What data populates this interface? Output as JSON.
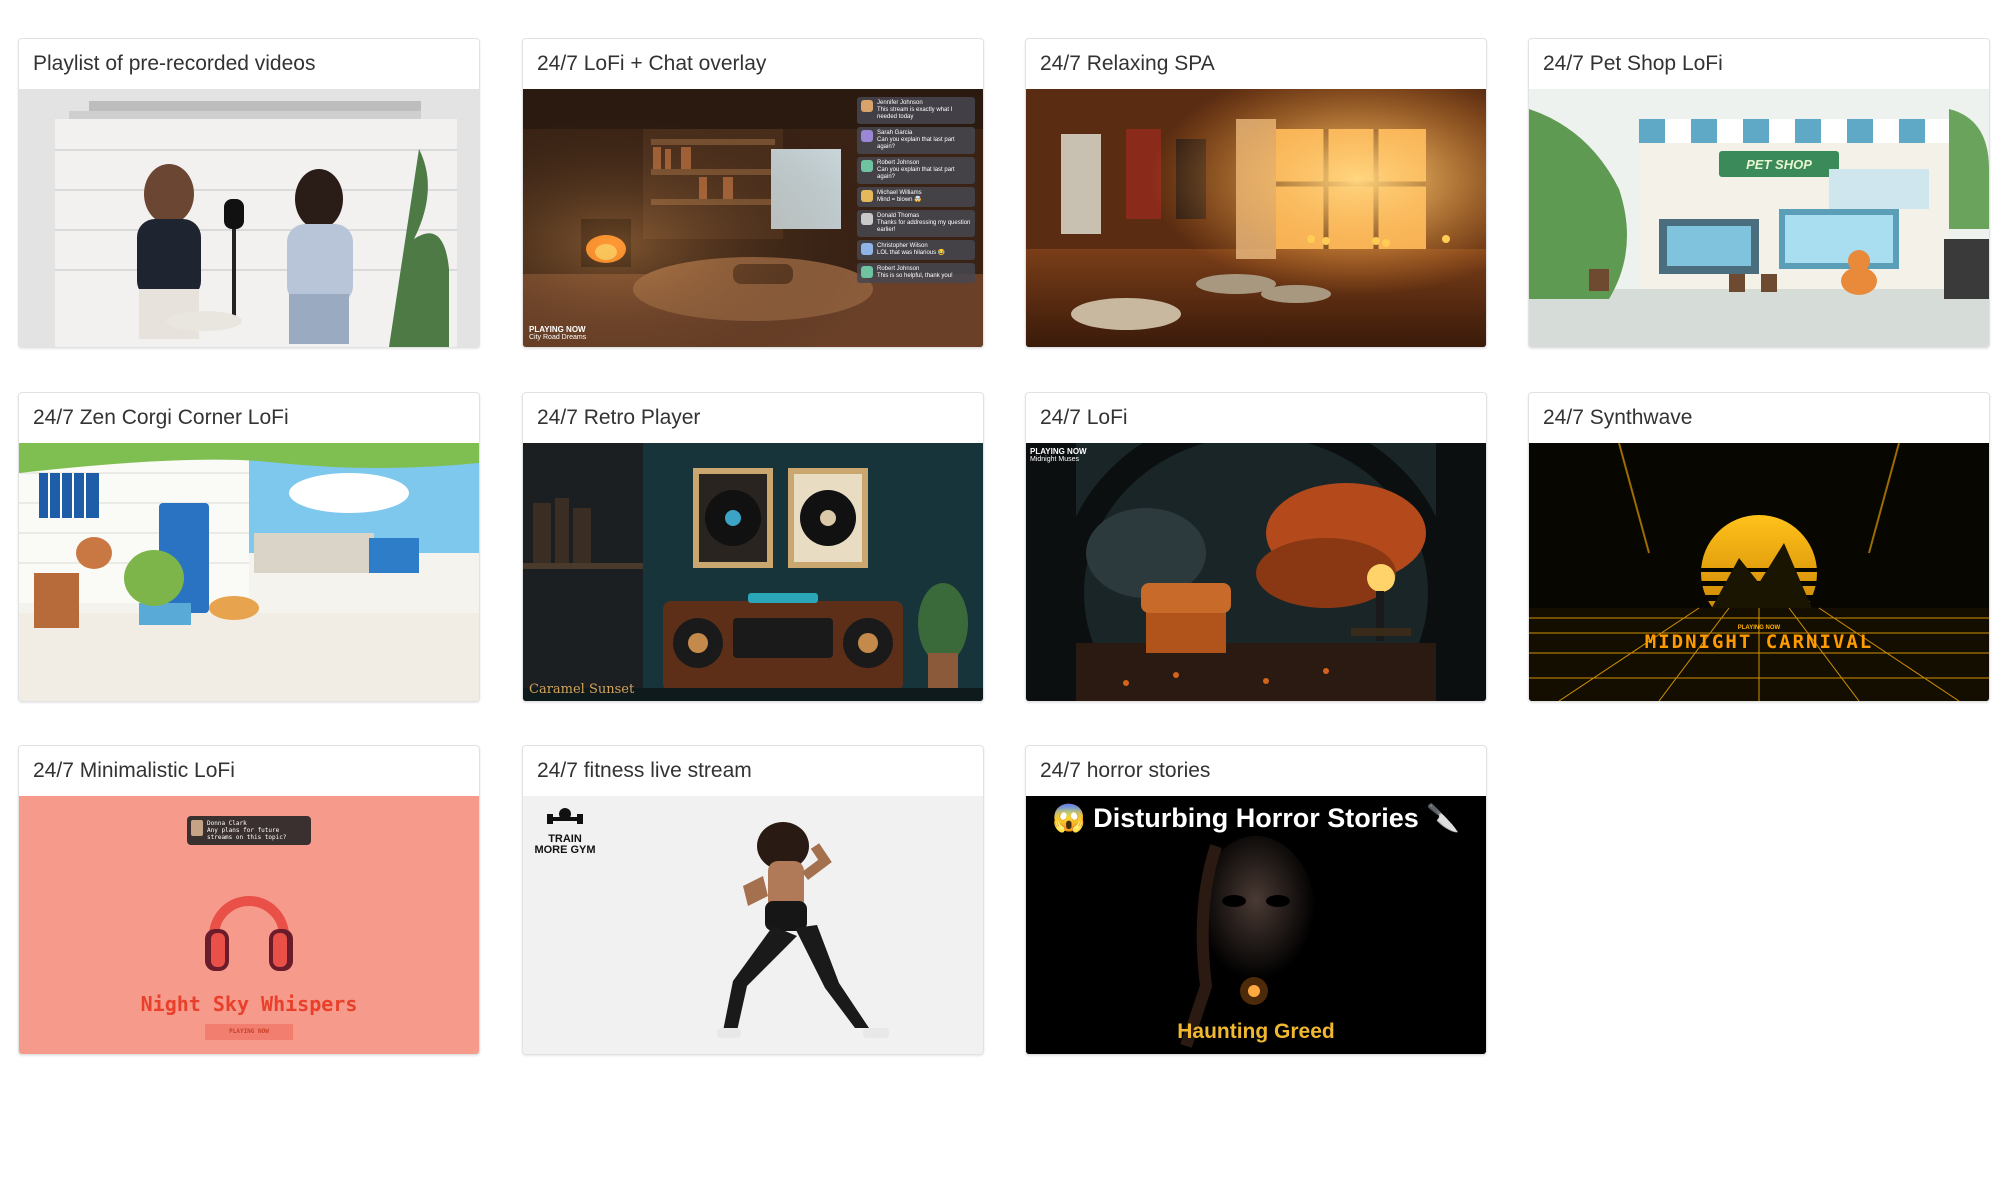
{
  "cards": [
    {
      "title": "Playlist of pre-recorded videos"
    },
    {
      "title": "24/7 LoFi + Chat overlay",
      "overlay": {
        "playing_label": "PLAYING NOW",
        "track": "City Road Dreams",
        "chat": [
          {
            "name": "Jennifer Johnson",
            "msg": "This stream is exactly what I needed today"
          },
          {
            "name": "Sarah Garcia",
            "msg": "Can you explain that last part again?"
          },
          {
            "name": "Robert Johnson",
            "msg": "Can you explain that last part again?"
          },
          {
            "name": "Michael Williams",
            "msg": "Mind = blown 🤯"
          },
          {
            "name": "Donald Thomas",
            "msg": "Thanks for addressing my question earlier!"
          },
          {
            "name": "Christopher Wilson",
            "msg": "LOL that was hilarious 😂"
          },
          {
            "name": "Robert Johnson",
            "msg": "This is so helpful, thank you!"
          }
        ]
      }
    },
    {
      "title": "24/7 Relaxing SPA"
    },
    {
      "title": "24/7 Pet Shop LoFi",
      "overlay": {
        "sign": "PET SHOP"
      }
    },
    {
      "title": "24/7 Zen Corgi Corner LoFi"
    },
    {
      "title": "24/7 Retro Player",
      "overlay": {
        "track": "Caramel Sunset"
      }
    },
    {
      "title": "24/7 LoFi",
      "overlay": {
        "playing_label": "PLAYING NOW",
        "track": "Midnight Muses"
      }
    },
    {
      "title": "24/7 Synthwave",
      "overlay": {
        "playing_label": "PLAYING NOW",
        "track": "MIDNIGHT CARNIVAL"
      }
    },
    {
      "title": "24/7 Minimalistic LoFi",
      "overlay": {
        "chat_name": "Donna Clark",
        "chat_msg": "Any plans for future streams on this topic?",
        "track": "Night Sky Whispers",
        "playing_label": "PLAYING NOW"
      }
    },
    {
      "title": "24/7 fitness live stream",
      "overlay": {
        "logo": "TRAIN MORE GYM"
      }
    },
    {
      "title": "24/7 horror stories",
      "overlay": {
        "heading": "😱 Disturbing Horror Stories 🔪",
        "track": "Haunting Greed"
      }
    }
  ],
  "colors": {
    "card_border": "#e2e2e2",
    "title_text": "#333333",
    "synth_orange": "#ffb100",
    "minimal_bg": "#f69a8c"
  }
}
